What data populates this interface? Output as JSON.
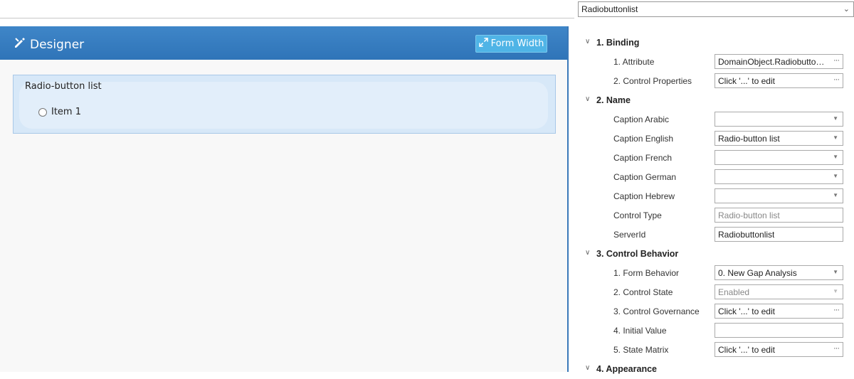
{
  "designer": {
    "title": "Designer",
    "form_width_label": "Form Width",
    "control": {
      "caption": "Radio-button list",
      "items": [
        "Item 1"
      ]
    }
  },
  "panel": {
    "object_selector": "Radiobuttonlist",
    "categories": [
      {
        "label": "1. Binding",
        "props": [
          {
            "label": "1. Attribute",
            "value": "DomainObject.Radiobuttonli...",
            "editor": "ellipsis"
          },
          {
            "label": "2. Control Properties",
            "value": "Click '...' to edit",
            "editor": "ellipsis"
          }
        ]
      },
      {
        "label": "2. Name",
        "props": [
          {
            "label": "Caption Arabic",
            "value": "",
            "editor": "dropdown"
          },
          {
            "label": "Caption English",
            "value": "Radio-button list",
            "editor": "dropdown"
          },
          {
            "label": "Caption French",
            "value": "",
            "editor": "dropdown"
          },
          {
            "label": "Caption German",
            "value": "",
            "editor": "dropdown"
          },
          {
            "label": "Caption Hebrew",
            "value": "",
            "editor": "dropdown"
          },
          {
            "label": "Control Type",
            "value": "Radio-button list",
            "editor": "readonly"
          },
          {
            "label": "ServerId",
            "value": "Radiobuttonlist",
            "editor": "text"
          }
        ]
      },
      {
        "label": "3. Control Behavior",
        "props": [
          {
            "label": "1. Form Behavior",
            "value": "0. New Gap Analysis",
            "editor": "dropdown"
          },
          {
            "label": "2. Control State",
            "value": "Enabled",
            "editor": "dropdown-disabled"
          },
          {
            "label": "3. Control Governance",
            "value": "Click '...' to edit",
            "editor": "ellipsis"
          },
          {
            "label": "4. Initial Value",
            "value": "",
            "editor": "text"
          },
          {
            "label": "5. State Matrix",
            "value": "Click '...' to edit",
            "editor": "ellipsis"
          }
        ]
      },
      {
        "label": "4. Appearance",
        "props": []
      }
    ]
  },
  "icons": {
    "designer": "pencil-ruler-icon",
    "form_width": "expand-arrows-icon",
    "category_toggle": "chevron-down-icon",
    "dropdown": "triangle-down-icon",
    "ellipsis": "ellipsis-icon"
  },
  "colors": {
    "header_blue": "#2f74b8",
    "button_blue": "#4fb4e6",
    "control_bg": "#d7e8f8"
  }
}
